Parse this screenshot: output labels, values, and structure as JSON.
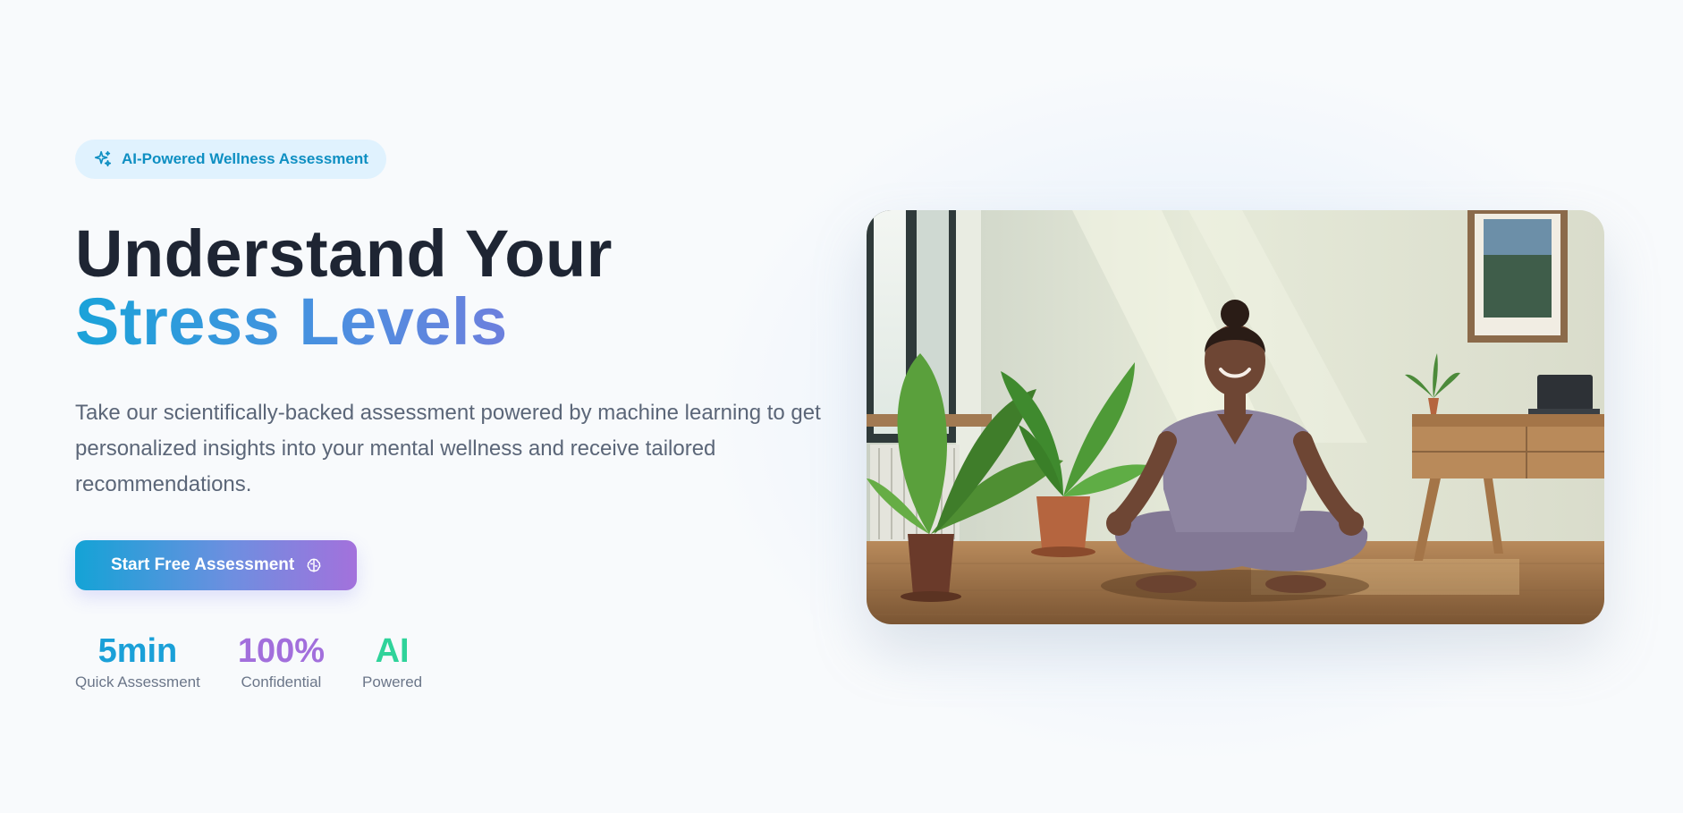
{
  "badge": {
    "icon": "sparkles-icon",
    "label": "AI-Powered Wellness Assessment"
  },
  "hero": {
    "title_line1": "Understand Your",
    "title_line2": "Stress Levels",
    "description": "Take our scientifically-backed assessment powered by machine learning to get personalized insights into your mental wellness and receive tailored recommendations."
  },
  "cta": {
    "label": "Start Free Assessment",
    "icon": "brain-icon"
  },
  "stats": [
    {
      "value": "5min",
      "label": "Quick Assessment",
      "color": "#1aa0d8"
    },
    {
      "value": "100%",
      "label": "Confidential",
      "color": "#a26fdc"
    },
    {
      "value": "AI",
      "label": "Powered",
      "color": "#2fd39a"
    }
  ],
  "colors": {
    "accent_blue": "#1aa3d9",
    "accent_purple": "#a371dc",
    "heading": "#1e2533",
    "badge_bg": "#e0f2fe"
  }
}
